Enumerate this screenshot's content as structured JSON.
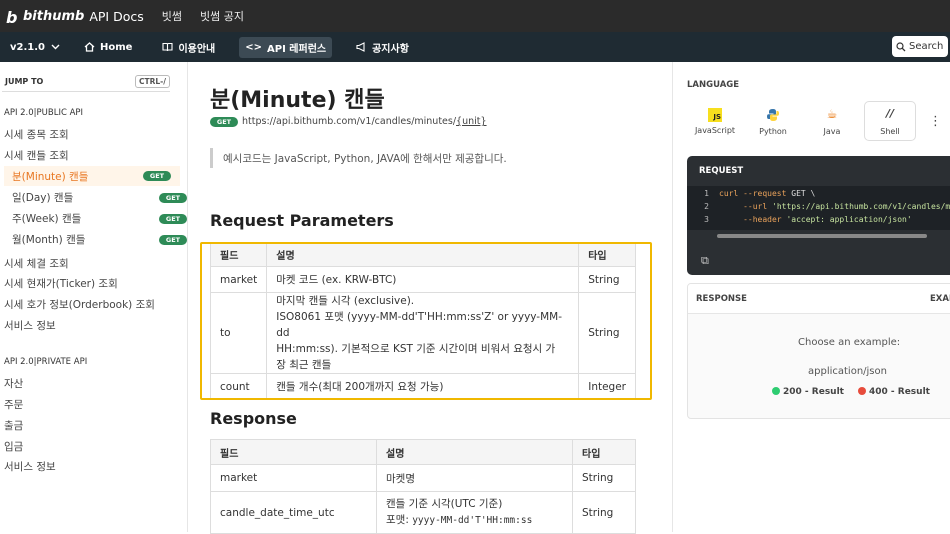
{
  "topbar": {
    "logo_brand": "bithumb",
    "logo_docs": "API Docs",
    "links": [
      "빗썸",
      "빗썸 공지"
    ]
  },
  "navbar": {
    "version": "v2.1.0",
    "items": [
      "Home",
      "이용안내",
      "API 레퍼런스",
      "공지사항"
    ],
    "search_label": "Search"
  },
  "sidebar": {
    "jump_to": "JUMP TO",
    "jump_kbd": "CTRL-/",
    "public_title": "API 2.0|PUBLIC API",
    "public_items": [
      "시세 종목 조회",
      "시세 캔들 조회"
    ],
    "candle_items": [
      "분(Minute) 캔들",
      "일(Day) 캔들",
      "주(Week) 캔들",
      "월(Month) 캔들"
    ],
    "get_badge": "GET",
    "public_items2": [
      "시세 체결 조회",
      "시세 현재가(Ticker) 조회",
      "시세 호가 정보(Orderbook) 조회",
      "서비스 정보"
    ],
    "private_title": "API 2.0|PRIVATE API",
    "private_items": [
      "자산",
      "주문",
      "출금",
      "입금",
      "서비스 정보"
    ]
  },
  "main": {
    "title": "분(Minute) 캔들",
    "method": "GET",
    "url": "https://api.bithumb.com/v1/candles/minutes/",
    "url_unit": "{unit}",
    "note": "예시코드는 JavaScript, Python, JAVA에 한해서만 제공합니다.",
    "request_title": "Request Parameters",
    "request_headers": [
      "필드",
      "설명",
      "타입"
    ],
    "request_rows": [
      {
        "field": "market",
        "desc": "마켓 코드 (ex. KRW-BTC)",
        "type": "String"
      },
      {
        "field": "to",
        "desc_lines": [
          "마지막 캔들 시각 (exclusive).",
          "ISO8061 포맷 (yyyy-MM-dd'T'HH:mm:ss'Z' or yyyy-MM-dd",
          "HH:mm:ss). 기본적으로 KST 기준 시간이며 비워서 요청시 가",
          "장 최근 캔들"
        ],
        "type": "String"
      },
      {
        "field": "count",
        "desc": "캔들 개수(최대 200개까지 요청 가능)",
        "type": "Integer"
      }
    ],
    "response_title": "Response",
    "response_headers": [
      "필드",
      "설명",
      "타입"
    ],
    "response_rows": [
      {
        "field": "market",
        "desc": "마켓명",
        "type": "String"
      },
      {
        "field": "candle_date_time_utc",
        "desc_line1": "캔들 기준 시각(UTC 기준)",
        "desc_line2_prefix": "포맷: ",
        "desc_line2_mono": "yyyy-MM-dd'T'HH:mm:ss",
        "type": "String"
      }
    ]
  },
  "right": {
    "language_title": "LANGUAGE",
    "languages": [
      "JavaScript",
      "Python",
      "Java",
      "Shell"
    ],
    "request_title": "REQUEST",
    "code_lines": [
      {
        "n": "1",
        "a": "curl ",
        "b": "--request",
        "c": " GET \\"
      },
      {
        "n": "2",
        "a": "     ",
        "b": "--url",
        "c": " 'https://api.bithumb.com/v1/candles/mi"
      },
      {
        "n": "3",
        "a": "     ",
        "b": "--header",
        "c": " 'accept: application/json'"
      }
    ],
    "response_title": "RESPONSE",
    "examples_label": "EXAM",
    "choose": "Choose an example:",
    "mime": "application/json",
    "result_200": "200 - Result",
    "result_400": "400 - Result",
    "colors": {
      "ok": "#2ecc71",
      "err": "#e74c3c",
      "accent": "#e87722",
      "highlight": "#f0b800"
    }
  }
}
